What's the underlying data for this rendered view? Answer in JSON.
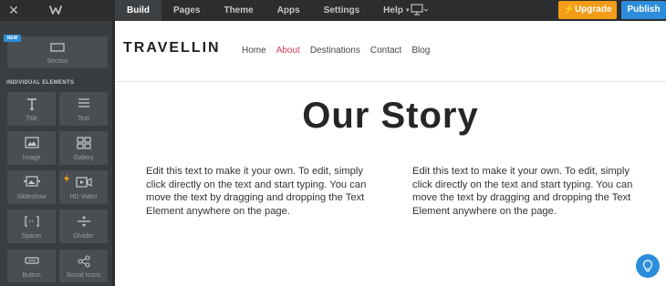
{
  "topbar": {
    "tabs": [
      "Build",
      "Pages",
      "Theme",
      "Apps",
      "Settings",
      "Help"
    ],
    "upgrade_label": "Upgrade",
    "publish_label": "Publish"
  },
  "sidebar": {
    "new_badge": "NEW",
    "section_tile_label": "Section",
    "heading": "INDIVIDUAL ELEMENTS",
    "elements": [
      {
        "label": "Title",
        "icon": "title-icon"
      },
      {
        "label": "Text",
        "icon": "text-icon"
      },
      {
        "label": "Image",
        "icon": "image-icon"
      },
      {
        "label": "Gallery",
        "icon": "gallery-icon"
      },
      {
        "label": "Slideshow",
        "icon": "slideshow-icon"
      },
      {
        "label": "HD Video",
        "icon": "hd-video-icon"
      },
      {
        "label": "Spacer",
        "icon": "spacer-icon"
      },
      {
        "label": "Divider",
        "icon": "divider-icon"
      },
      {
        "label": "Button",
        "icon": "button-icon"
      },
      {
        "label": "Social Icons",
        "icon": "social-icons-icon"
      }
    ]
  },
  "site": {
    "brand": "TRAVELLIN",
    "nav": [
      "Home",
      "About",
      "Destinations",
      "Contact",
      "Blog"
    ],
    "active_nav": "About",
    "hero_title": "Our Story",
    "body_left": "Edit this text to make it your own. To edit, simply click directly on the text and start typing. You can move the text by dragging and dropping the Text Element anywhere on the page.",
    "body_right": "Edit this text to make it your own. To edit, simply click directly on the text and start typing. You can move the text by dragging and dropping the Text Element anywhere on the page."
  },
  "colors": {
    "topbar_bg": "#2b2d2e",
    "sidebar_bg": "#3a3d40",
    "tile_bg": "#4a4d51",
    "upgrade": "#f39c17",
    "publish": "#2c8ddb",
    "nav_active": "#d8405f"
  }
}
